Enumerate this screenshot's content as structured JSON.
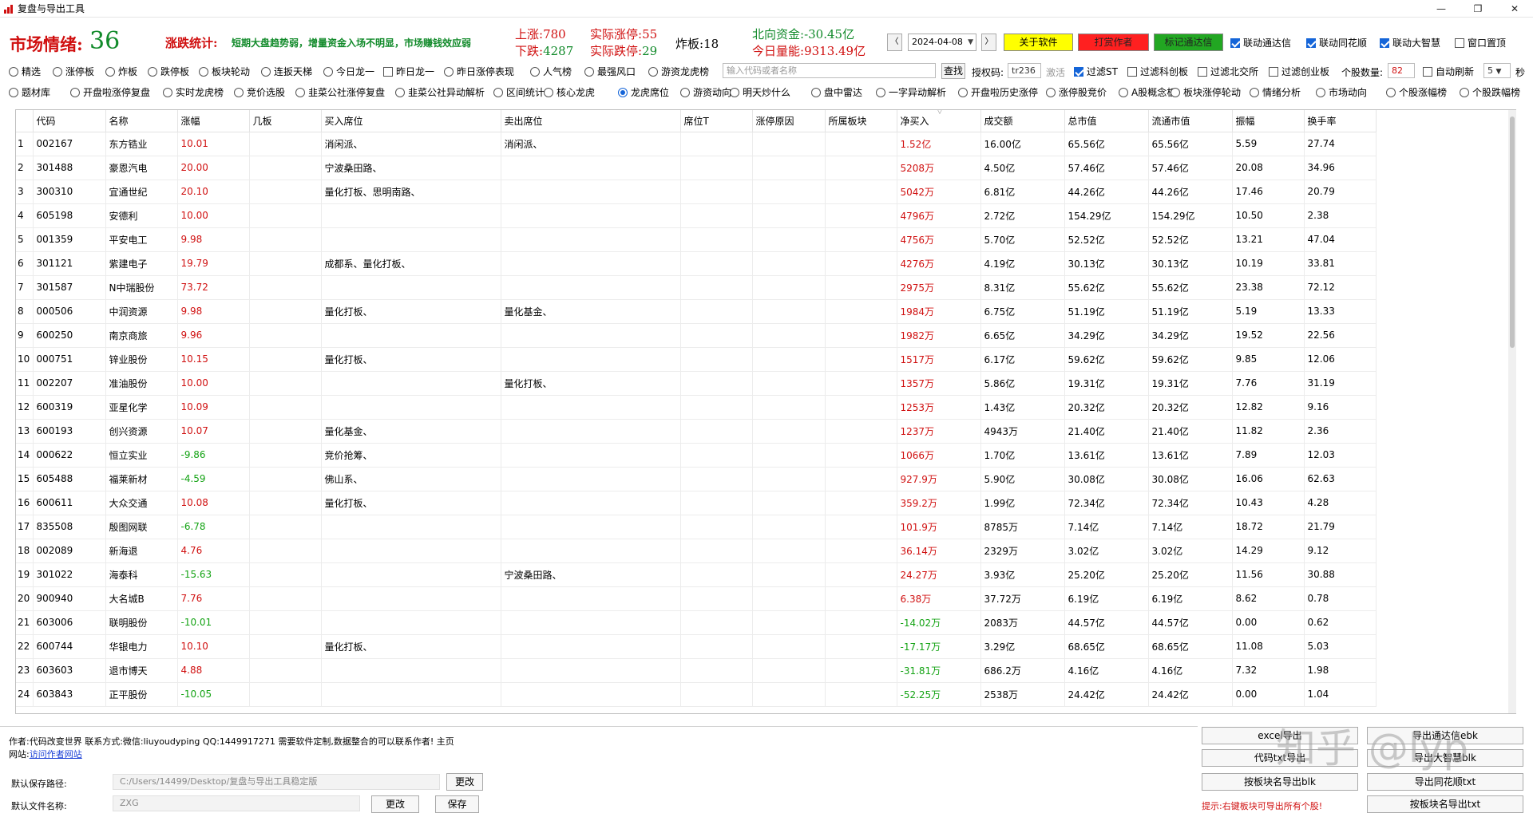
{
  "window": {
    "title": "复盘与导出工具",
    "min_icon": "minimize-icon",
    "max_icon": "maximize-icon",
    "close_icon": "close-icon"
  },
  "header": {
    "mood_label": "市场情绪:",
    "mood_value": "36",
    "stat_label": "涨跌统计:",
    "stat_text": "短期大盘趋势弱，增量资金入场不明显，市场赚钱效应弱",
    "up_label": "上涨:",
    "up_value": "780",
    "down_label": "下跌:",
    "down_value": "4287",
    "limit_up_label": "实际涨停:",
    "limit_up_value": "55",
    "limit_down_label": "实际跌停:",
    "limit_down_value": "29",
    "broken_label": "炸板:",
    "broken_value": "18",
    "north_label": "北向资金:",
    "north_value": "-30.45亿",
    "volume_label": "今日量能:",
    "volume_value": "9313.49亿",
    "date": "2024-04-08",
    "btn_about": "关于软件",
    "btn_hit": "打赏作者",
    "btn_tdx": "标记通达信",
    "chk_tdx": "联动通达信",
    "chk_ths": "联动同花顺",
    "chk_dzh": "联动大智慧",
    "chk_top": "窗口置顶"
  },
  "colors": {
    "red": "#d01010",
    "green": "#118a2a",
    "yellow": "#ffff00",
    "btn_red": "#ff0000",
    "btn_green": "#22a722",
    "accent": "#1565d8"
  },
  "radios1": [
    "精选",
    "涨停板",
    "炸板",
    "跌停板",
    "板块轮动",
    "连扳天梯",
    "今日龙一",
    "昨日龙一",
    "昨日涨停表现",
    "人气榜",
    "最强风口",
    "游资龙虎榜"
  ],
  "search_placeholder": "输入代码或者名称",
  "search_btn": "查找",
  "auth_label": "授权码:",
  "auth_value": "tr236",
  "activate": "激活",
  "filters": [
    "过滤ST",
    "过滤科创板",
    "过滤北交所",
    "过滤创业板"
  ],
  "stock_count_label": "个股数量:",
  "stock_count_value": "82",
  "auto_refresh": "自动刷新",
  "refresh_value": "5",
  "refresh_unit": "秒",
  "radios2": [
    "题材库",
    "开盘啦涨停复盘",
    "实时龙虎榜",
    "竞价选股",
    "韭菜公社涨停复盘",
    "韭菜公社异动解析",
    "区间统计",
    "核心龙虎",
    "龙虎席位",
    "游资动向",
    "明天炒什么",
    "盘中雷达",
    "一字异动解析",
    "开盘啦历史涨停",
    "涨停股竞价",
    "A股概念板",
    "板块涨停轮动",
    "情绪分析",
    "市场动向",
    "个股涨幅榜",
    "个股跌幅榜"
  ],
  "table": {
    "columns": [
      "代码",
      "名称",
      "涨幅",
      "几板",
      "买入席位",
      "卖出席位",
      "席位T",
      "涨停原因",
      "所属板块",
      "净买入",
      "成交额",
      "总市值",
      "流通市值",
      "振幅",
      "换手率"
    ],
    "rows": [
      [
        "1",
        "002167",
        "东方锆业",
        "10.01",
        "",
        "消闲派、",
        "消闲派、",
        "",
        "",
        "",
        "1.52亿",
        "16.00亿",
        "65.56亿",
        "65.56亿",
        "5.59",
        "27.74"
      ],
      [
        "2",
        "301488",
        "豪恩汽电",
        "20.00",
        "",
        "宁波桑田路、",
        "",
        "",
        "",
        "",
        "5208万",
        "4.50亿",
        "57.46亿",
        "57.46亿",
        "20.08",
        "34.96"
      ],
      [
        "3",
        "300310",
        "宜通世纪",
        "20.10",
        "",
        "量化打板、思明南路、",
        "",
        "",
        "",
        "",
        "5042万",
        "6.81亿",
        "44.26亿",
        "44.26亿",
        "17.46",
        "20.79"
      ],
      [
        "4",
        "605198",
        "安德利",
        "10.00",
        "",
        "",
        "",
        "",
        "",
        "",
        "4796万",
        "2.72亿",
        "154.29亿",
        "154.29亿",
        "10.50",
        "2.38"
      ],
      [
        "5",
        "001359",
        "平安电工",
        "9.98",
        "",
        "",
        "",
        "",
        "",
        "",
        "4756万",
        "5.70亿",
        "52.52亿",
        "52.52亿",
        "13.21",
        "47.04"
      ],
      [
        "6",
        "301121",
        "紫建电子",
        "19.79",
        "",
        "成都系、量化打板、",
        "",
        "",
        "",
        "",
        "4276万",
        "4.19亿",
        "30.13亿",
        "30.13亿",
        "10.19",
        "33.81"
      ],
      [
        "7",
        "301587",
        "N中瑞股份",
        "73.72",
        "",
        "",
        "",
        "",
        "",
        "",
        "2975万",
        "8.31亿",
        "55.62亿",
        "55.62亿",
        "23.38",
        "72.12"
      ],
      [
        "8",
        "000506",
        "中润资源",
        "9.98",
        "",
        "量化打板、",
        "量化基金、",
        "",
        "",
        "",
        "1984万",
        "6.75亿",
        "51.19亿",
        "51.19亿",
        "5.19",
        "13.33"
      ],
      [
        "9",
        "600250",
        "南京商旅",
        "9.96",
        "",
        "",
        "",
        "",
        "",
        "",
        "1982万",
        "6.65亿",
        "34.29亿",
        "34.29亿",
        "19.52",
        "22.56"
      ],
      [
        "10",
        "000751",
        "锌业股份",
        "10.15",
        "",
        "量化打板、",
        "",
        "",
        "",
        "",
        "1517万",
        "6.17亿",
        "59.62亿",
        "59.62亿",
        "9.85",
        "12.06"
      ],
      [
        "11",
        "002207",
        "准油股份",
        "10.00",
        "",
        "",
        "量化打板、",
        "",
        "",
        "",
        "1357万",
        "5.86亿",
        "19.31亿",
        "19.31亿",
        "7.76",
        "31.19"
      ],
      [
        "12",
        "600319",
        "亚星化学",
        "10.09",
        "",
        "",
        "",
        "",
        "",
        "",
        "1253万",
        "1.43亿",
        "20.32亿",
        "20.32亿",
        "12.82",
        "9.16"
      ],
      [
        "13",
        "600193",
        "创兴资源",
        "10.07",
        "",
        "量化基金、",
        "",
        "",
        "",
        "",
        "1237万",
        "4943万",
        "21.40亿",
        "21.40亿",
        "11.82",
        "2.36"
      ],
      [
        "14",
        "000622",
        "恒立实业",
        "-9.86",
        "",
        "竞价抢筹、",
        "",
        "",
        "",
        "",
        "1066万",
        "1.70亿",
        "13.61亿",
        "13.61亿",
        "7.89",
        "12.03"
      ],
      [
        "15",
        "605488",
        "福莱新材",
        "-4.59",
        "",
        "佛山系、",
        "",
        "",
        "",
        "",
        "927.9万",
        "5.90亿",
        "30.08亿",
        "30.08亿",
        "16.06",
        "62.63"
      ],
      [
        "16",
        "600611",
        "大众交通",
        "10.08",
        "",
        "量化打板、",
        "",
        "",
        "",
        "",
        "359.2万",
        "1.99亿",
        "72.34亿",
        "72.34亿",
        "10.43",
        "4.28"
      ],
      [
        "17",
        "835508",
        "殷图网联",
        "-6.78",
        "",
        "",
        "",
        "",
        "",
        "",
        "101.9万",
        "8785万",
        "7.14亿",
        "7.14亿",
        "18.72",
        "21.79"
      ],
      [
        "18",
        "002089",
        "新海退",
        "4.76",
        "",
        "",
        "",
        "",
        "",
        "",
        "36.14万",
        "2329万",
        "3.02亿",
        "3.02亿",
        "14.29",
        "9.12"
      ],
      [
        "19",
        "301022",
        "海泰科",
        "-15.63",
        "",
        "",
        "宁波桑田路、",
        "",
        "",
        "",
        "24.27万",
        "3.93亿",
        "25.20亿",
        "25.20亿",
        "11.56",
        "30.88"
      ],
      [
        "20",
        "900940",
        "大名城B",
        "7.76",
        "",
        "",
        "",
        "",
        "",
        "",
        "6.38万",
        "37.72万",
        "6.19亿",
        "6.19亿",
        "8.62",
        "0.78"
      ],
      [
        "21",
        "603006",
        "联明股份",
        "-10.01",
        "",
        "",
        "",
        "",
        "",
        "",
        "-14.02万",
        "2083万",
        "44.57亿",
        "44.57亿",
        "0.00",
        "0.62"
      ],
      [
        "22",
        "600744",
        "华银电力",
        "10.10",
        "",
        "量化打板、",
        "",
        "",
        "",
        "",
        "-17.17万",
        "3.29亿",
        "68.65亿",
        "68.65亿",
        "11.08",
        "5.03"
      ],
      [
        "23",
        "603603",
        "退市博天",
        "4.88",
        "",
        "",
        "",
        "",
        "",
        "",
        "-31.81万",
        "686.2万",
        "4.16亿",
        "4.16亿",
        "7.32",
        "1.98"
      ],
      [
        "24",
        "603843",
        "正平股份",
        "-10.05",
        "",
        "",
        "",
        "",
        "",
        "",
        "-52.25万",
        "2538万",
        "24.42亿",
        "24.42亿",
        "0.00",
        "1.04"
      ]
    ]
  },
  "footer": {
    "author": "作者:代码改变世界 联系方式:微信:liuyoudyping QQ:1449917271 需要软件定制,数据整合的可以联系作者! 主页",
    "site_label": "网站:",
    "site_link": "访问作者网站",
    "save_path_label": "默认保存路径:",
    "save_path_value": "C:/Users/14499/Desktop/复盘与导出工具稳定版",
    "change_btn": "更改",
    "file_name_label": "默认文件名称:",
    "file_name_value": "ZXG",
    "change_btn2": "更改",
    "save_btn": "保存",
    "btn_excel": "excel导出",
    "btn_export_ebk": "导出通达信ebk",
    "btn_code": "代码txt导出",
    "btn_dzh": "导出大智慧blk",
    "btn_blk": "按板块名导出blk",
    "btn_ths": "导出同花顺txt",
    "btn_txt": "按板块名导出txt",
    "hint": "提示:右键板块可导出所有个股!",
    "watermark": "知乎 @lyp"
  }
}
